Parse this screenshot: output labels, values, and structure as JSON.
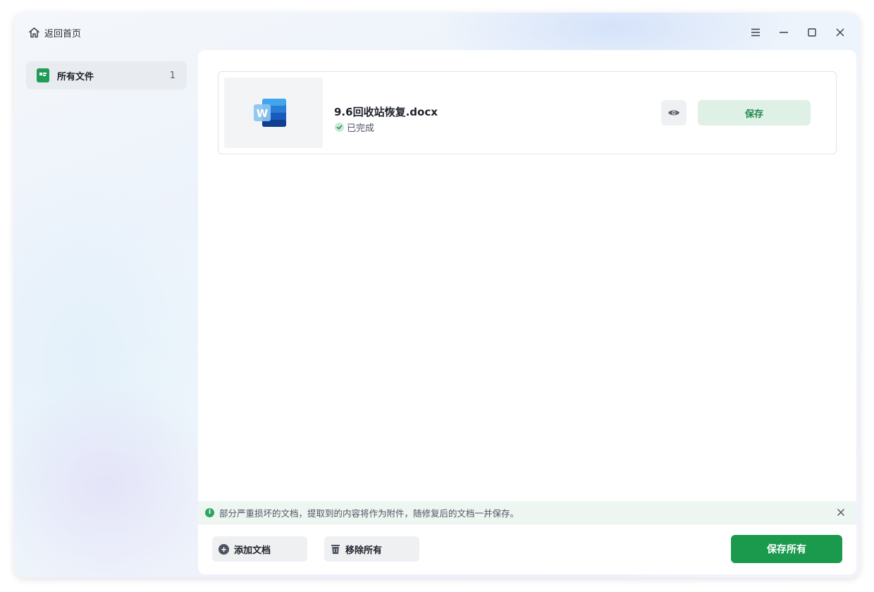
{
  "titlebar": {
    "back_label": "返回首页",
    "controls": [
      "menu-icon",
      "minimize-icon",
      "maximize-icon",
      "close-icon"
    ]
  },
  "sidebar": {
    "items": [
      {
        "label": "所有文件",
        "count": "1",
        "icon": "document-folder-icon"
      }
    ]
  },
  "files": [
    {
      "name": "9.6回收站恢复.docx",
      "status": "已完成",
      "type_icon": "word-document-icon",
      "save_label": "保存"
    }
  ],
  "notice": {
    "text": "部分严重损坏的文档，提取到的内容将作为附件，随修复后的文档一并保存。"
  },
  "footer": {
    "add_label": "添加文档",
    "remove_label": "移除所有",
    "save_all_label": "保存所有"
  },
  "colors": {
    "accent": "#1b9a4e",
    "accent_light": "#dff0e6",
    "notice_bg": "#eef6f1"
  }
}
